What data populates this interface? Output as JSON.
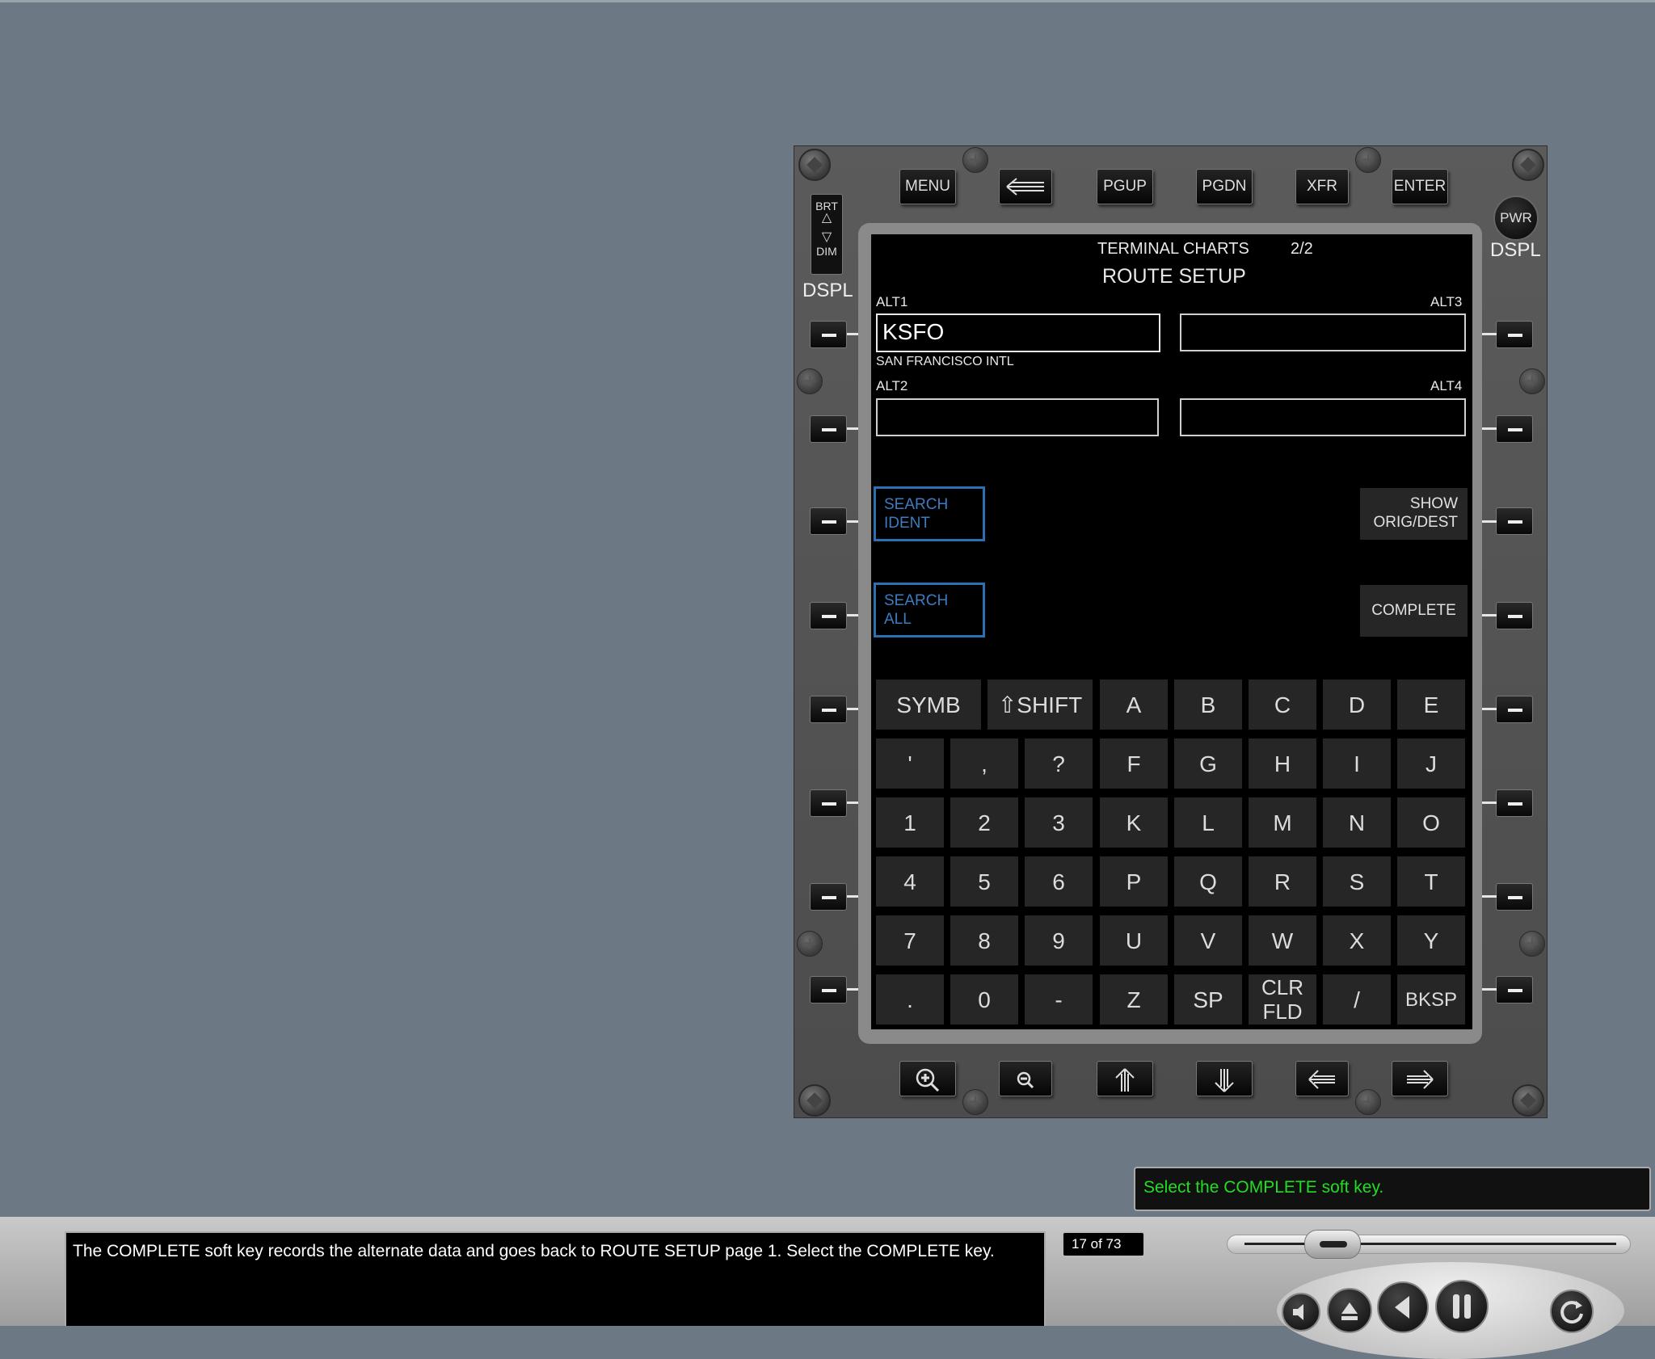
{
  "cdu": {
    "top_keys": {
      "menu": "MENU",
      "pgup": "PGUP",
      "pgdn": "PGDN",
      "xfr": "XFR",
      "enter": "ENTER"
    },
    "brt": "BRT",
    "dim": "DIM",
    "dspl": "DSPL",
    "pwr": "PWR",
    "screen": {
      "header": "TERMINAL CHARTS",
      "page": "2/2",
      "title": "ROUTE SETUP",
      "alt1_label": "ALT1",
      "alt1_value": "KSFO",
      "alt1_name": "SAN FRANCISCO INTL",
      "alt2_label": "ALT2",
      "alt3_label": "ALT3",
      "alt4_label": "ALT4",
      "search_ident": [
        "SEARCH",
        "IDENT"
      ],
      "search_all": [
        "SEARCH",
        "ALL"
      ],
      "show_origdest": [
        "SHOW",
        "ORIG/DEST"
      ],
      "complete": "COMPLETE"
    },
    "keyboard": [
      [
        "A",
        "B",
        "C",
        "D",
        "E"
      ],
      [
        "'",
        ",",
        "?",
        "F",
        "G",
        "H",
        "I",
        "J"
      ],
      [
        "1",
        "2",
        "3",
        "K",
        "L",
        "M",
        "N",
        "O"
      ],
      [
        "4",
        "5",
        "6",
        "P",
        "Q",
        "R",
        "S",
        "T"
      ],
      [
        "7",
        "8",
        "9",
        "U",
        "V",
        "W",
        "X",
        "Y"
      ],
      [
        ".",
        "0",
        "-",
        "Z",
        "SP",
        "CLR FLD",
        "/",
        "BKSP"
      ]
    ],
    "keyboard_special": {
      "symb": "SYMB",
      "shift": "⇧SHIFT",
      "clr1": "CLR",
      "clr2": "FLD"
    }
  },
  "lesson": {
    "caption": "The COMPLETE soft key records the alternate data and goes back to ROUTE SETUP page 1. Select the COMPLETE key.",
    "counter": "17 of 73",
    "instruction": "Select the COMPLETE soft key."
  },
  "colors": {
    "instruction": "#22dd22",
    "soft_key_blue": "#2c6fb3"
  }
}
